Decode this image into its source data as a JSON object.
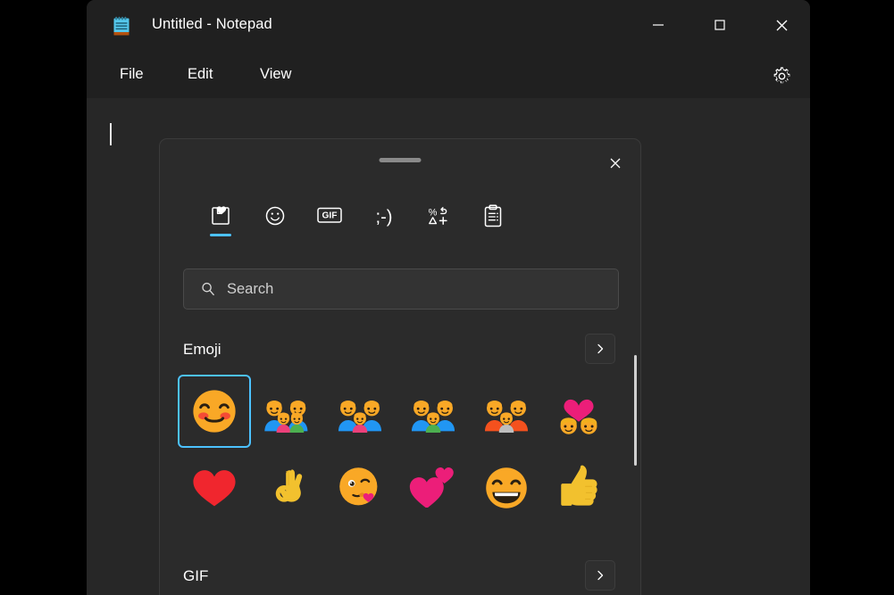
{
  "window": {
    "title": "Untitled - Notepad",
    "app_icon": "notepad-icon",
    "controls": {
      "minimize": "minimize-icon",
      "maximize": "maximize-icon",
      "close": "close-icon"
    },
    "menu": [
      {
        "label": "File"
      },
      {
        "label": "Edit"
      },
      {
        "label": "View"
      }
    ],
    "settings_icon": "gear-icon"
  },
  "emoji_panel": {
    "close_icon": "close-icon",
    "drag_handle": "drag-handle",
    "tabs": [
      {
        "name": "recently-used",
        "icon": "square-heart-icon",
        "active": true
      },
      {
        "name": "emoji",
        "icon": "smiley-face-icon",
        "active": false
      },
      {
        "name": "gif",
        "icon": "gif-icon",
        "label": "GIF",
        "active": false
      },
      {
        "name": "kaomoji",
        "icon": "kaomoji-icon",
        "label": ";-)",
        "active": false
      },
      {
        "name": "symbols",
        "icon": "symbols-icon",
        "active": false
      },
      {
        "name": "clipboard-history",
        "icon": "clipboard-icon",
        "active": false
      }
    ],
    "search": {
      "placeholder": "Search",
      "value": "",
      "icon": "search-icon"
    },
    "sections": [
      {
        "name": "emoji",
        "title": "Emoji",
        "expand_icon": "chevron-right-icon",
        "rows": [
          [
            {
              "name": "smiling-face-with-smiling-eyes",
              "selected": true
            },
            {
              "name": "family-man-woman-girl-boy",
              "selected": false
            },
            {
              "name": "family-man-woman-girl",
              "selected": false
            },
            {
              "name": "family-man-woman-boy",
              "selected": false
            },
            {
              "name": "family-man-man-boy",
              "selected": false
            },
            {
              "name": "couple-with-heart-woman-woman",
              "selected": false
            }
          ],
          [
            {
              "name": "red-heart",
              "selected": false
            },
            {
              "name": "ok-hand",
              "selected": false
            },
            {
              "name": "face-blowing-a-kiss",
              "selected": false
            },
            {
              "name": "two-hearts",
              "selected": false
            },
            {
              "name": "beaming-face-with-smiling-eyes",
              "selected": false
            },
            {
              "name": "thumbs-up",
              "selected": false
            }
          ]
        ]
      },
      {
        "name": "gif",
        "title": "GIF",
        "expand_icon": "chevron-right-icon",
        "rows": []
      }
    ],
    "scrollbar": {
      "name": "vertical-scrollbar"
    }
  },
  "colors": {
    "accent": "#4cc2ff",
    "window_bg": "#202020",
    "editor_bg": "#272727",
    "panel_bg": "#2b2b2b",
    "text": "#ffffff"
  }
}
